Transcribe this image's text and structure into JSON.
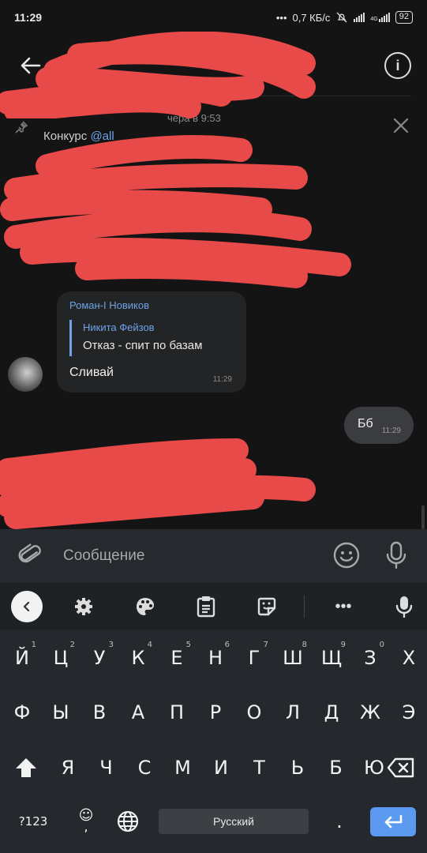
{
  "status_bar": {
    "time": "11:29",
    "speed": "0,7 КБ/с",
    "network_label": "4G",
    "battery": "92"
  },
  "pinned": {
    "date": "чера в 9:53",
    "title": "Конкурс ",
    "mention": "@all"
  },
  "messages": {
    "incoming": {
      "author": "Роман-I Новиков",
      "reply_author": "Никита Фейзов",
      "reply_text": "Отказ - спит по базам",
      "text": "Сливай",
      "time": "11:29"
    },
    "outgoing": {
      "text": "Бб",
      "time": "11:29"
    }
  },
  "composer": {
    "placeholder": "Сообщение"
  },
  "keyboard": {
    "row1": [
      {
        "label": "Й",
        "hint": "1"
      },
      {
        "label": "Ц",
        "hint": "2"
      },
      {
        "label": "У",
        "hint": "3"
      },
      {
        "label": "К",
        "hint": "4"
      },
      {
        "label": "Е",
        "hint": "5"
      },
      {
        "label": "Н",
        "hint": "6"
      },
      {
        "label": "Г",
        "hint": "7"
      },
      {
        "label": "Ш",
        "hint": "8"
      },
      {
        "label": "Щ",
        "hint": "9"
      },
      {
        "label": "З",
        "hint": "0"
      },
      {
        "label": "Х",
        "hint": ""
      }
    ],
    "row2": [
      "Ф",
      "Ы",
      "В",
      "А",
      "П",
      "Р",
      "О",
      "Л",
      "Д",
      "Ж",
      "Э"
    ],
    "row3": [
      "Я",
      "Ч",
      "С",
      "М",
      "И",
      "Т",
      "Ь",
      "Б",
      "Ю"
    ],
    "symbols_key": "?123",
    "space_label": "Русский",
    "period": "."
  },
  "colors": {
    "accent": "#6ea3e8",
    "redaction": "#e84a4a",
    "enter_key": "#5b9af0"
  }
}
